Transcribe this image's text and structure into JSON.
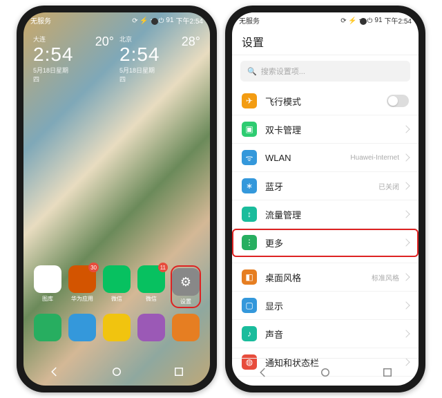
{
  "status": {
    "carrier": "无服务",
    "icons": "⟳ ⚡ ᯤ ⏻",
    "battery": "91",
    "time": "下午2:54"
  },
  "home": {
    "clocks": [
      {
        "loc": "大连",
        "time": "2:54",
        "date": "5月18日星期四",
        "temp": "20°"
      },
      {
        "loc": "北京",
        "time": "2:54",
        "date": "5月18日星期四",
        "temp": "28°"
      }
    ],
    "row1": [
      {
        "label": "图库",
        "badge": "",
        "color": "#fff"
      },
      {
        "label": "华为应用",
        "badge": "30",
        "color": "#d35400"
      },
      {
        "label": "微信",
        "badge": "",
        "color": "#07C160"
      },
      {
        "label": "微信",
        "badge": "11",
        "color": "#07C160"
      },
      {
        "label": "设置",
        "badge": "",
        "color": "#888",
        "highlight": true
      }
    ],
    "dock": [
      {
        "color": "#27ae60"
      },
      {
        "color": "#3498db"
      },
      {
        "color": "#f1c40f"
      },
      {
        "color": "#9b59b6"
      },
      {
        "color": "#e67e22"
      }
    ]
  },
  "settings": {
    "title": "设置",
    "search": "搜索设置项...",
    "rows": [
      {
        "icon": "✈",
        "bg": "#f39c12",
        "label": "飞行模式",
        "toggle": true
      },
      {
        "icon": "▣",
        "bg": "#2ecc71",
        "label": "双卡管理"
      },
      {
        "icon": "ᯤ",
        "bg": "#3498db",
        "label": "WLAN",
        "value": "Huawei-Internet"
      },
      {
        "icon": "∗",
        "bg": "#3498db",
        "label": "蓝牙",
        "value": "已关闭"
      },
      {
        "icon": "↕",
        "bg": "#1abc9c",
        "label": "流量管理"
      },
      {
        "icon": "⋮",
        "bg": "#27ae60",
        "label": "更多",
        "highlight": true
      },
      {
        "icon": "◧",
        "bg": "#e67e22",
        "label": "桌面风格",
        "value": "标准风格",
        "gap": true
      },
      {
        "icon": "▢",
        "bg": "#3498db",
        "label": "显示"
      },
      {
        "icon": "♪",
        "bg": "#1abc9c",
        "label": "声音"
      },
      {
        "icon": "◍",
        "bg": "#e74c3c",
        "label": "通知和状态栏"
      }
    ]
  }
}
